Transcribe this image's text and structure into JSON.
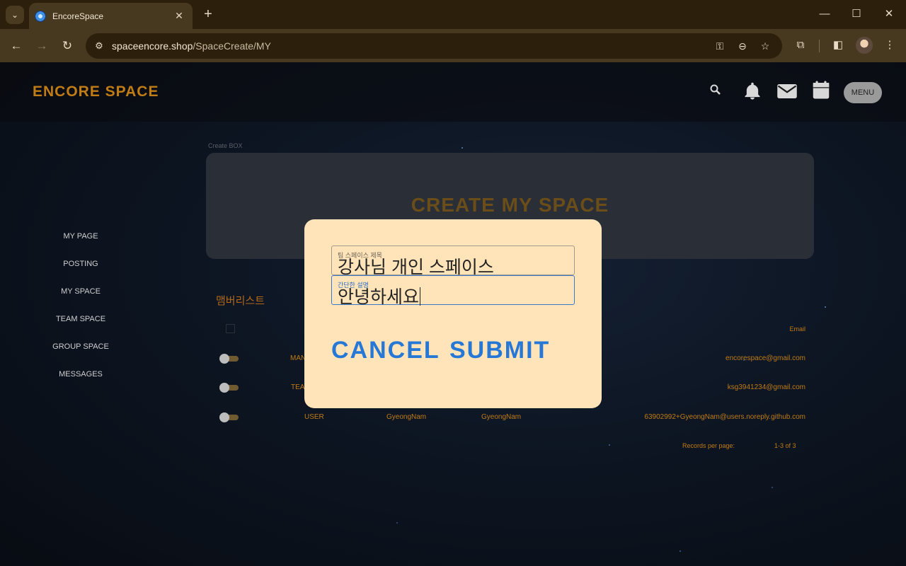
{
  "browser": {
    "tab_title": "EncoreSpace",
    "url_host": "spaceencore.shop",
    "url_path": "/SpaceCreate/MY"
  },
  "header": {
    "brand": "ENCORE SPACE",
    "menu_label": "MENU"
  },
  "sidebar": {
    "items": [
      {
        "label": "MY PAGE"
      },
      {
        "label": "POSTING"
      },
      {
        "label": "MY SPACE"
      },
      {
        "label": "TEAM SPACE"
      },
      {
        "label": "GROUP SPACE"
      },
      {
        "label": "MESSAGES"
      }
    ]
  },
  "create": {
    "label": "Create BOX",
    "title": "CREATE MY SPACE"
  },
  "members": {
    "title": "맴버리스트",
    "email_header": "Email",
    "rows": [
      {
        "role": "MAN",
        "name": "",
        "nickname": "",
        "email": "encorespace@gmail.com"
      },
      {
        "role": "TEA",
        "name": "",
        "nickname": "",
        "email": "ksg3941234@gmail.com"
      },
      {
        "role": "USER",
        "name": "GyeongNam",
        "nickname": "GyeongNam",
        "email": "63902992+GyeongNam@users.noreply.github.com"
      }
    ],
    "records_per_page_label": "Records per page:",
    "range": "1-3 of 3"
  },
  "modal": {
    "name_label": "팀 스페이스 제목",
    "name_value": "강사님 개인 스페이스",
    "desc_label": "간단한 설명",
    "desc_value": "안녕하세요",
    "cancel_label": "CANCEL",
    "submit_label": "SUBMIT"
  },
  "colors": {
    "accent": "#c07c15",
    "modal_bg": "#ffe4ba",
    "button_blue": "#2678d6"
  }
}
